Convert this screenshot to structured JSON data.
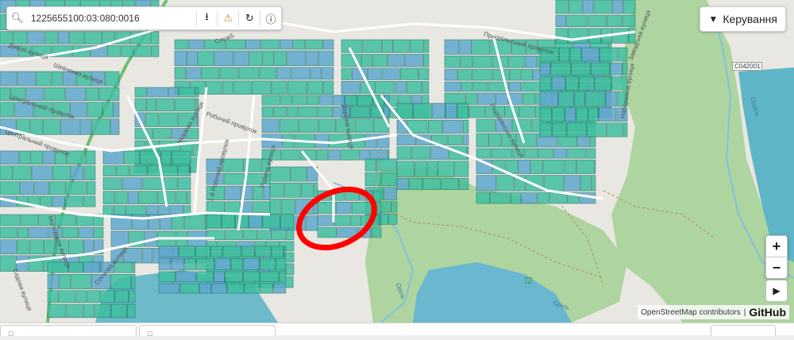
{
  "search": {
    "value": "1225655100:03:080:0016",
    "icon": "search-icon"
  },
  "toolbar": {
    "download_icon": "download-icon",
    "warning_icon": "warning-icon",
    "refresh_icon": "refresh-icon",
    "info_icon": "info-icon"
  },
  "manage": {
    "label": "Керування",
    "icon": "funnel-icon"
  },
  "zoom": {
    "in_label": "+",
    "out_label": "−"
  },
  "attribution": {
    "osm": "OpenStreetMap contributors",
    "separator": "|",
    "github": "GitHub"
  },
  "road_badge": "C042001",
  "streets": [
    {
      "name": "Шевченка вулиця"
    },
    {
      "name": "Центральний провулок"
    },
    {
      "name": "Центральний провулок"
    },
    {
      "name": "Чкалова вулиця"
    },
    {
      "name": "Робочий провулок"
    },
    {
      "name": "Робоча вулиця"
    },
    {
      "name": "1-й Робочий провулок"
    },
    {
      "name": "Приорільський провулок"
    },
    {
      "name": "Набережна вулиця"
    },
    {
      "name": "Заводська вулиця"
    },
    {
      "name": "Подолянська вулиця"
    },
    {
      "name": "Соснова вулиця"
    },
    {
      "name": "Молодіжна вулиця"
    },
    {
      "name": "Садова вулиця"
    },
    {
      "name": "Зарічна вулиця"
    },
    {
      "name": "Орріль"
    },
    {
      "name": "Оріль"
    },
    {
      "name": "Оріль"
    },
    {
      "name": "Служб."
    },
    {
      "name": "Дивізії вулиця"
    }
  ],
  "colors": {
    "parcel": "#3fbfa0",
    "parcel_blue": "#5fa8cf",
    "forest": "#aed4a0",
    "water": "#5fb5c8",
    "highlight": "#ff0000"
  }
}
